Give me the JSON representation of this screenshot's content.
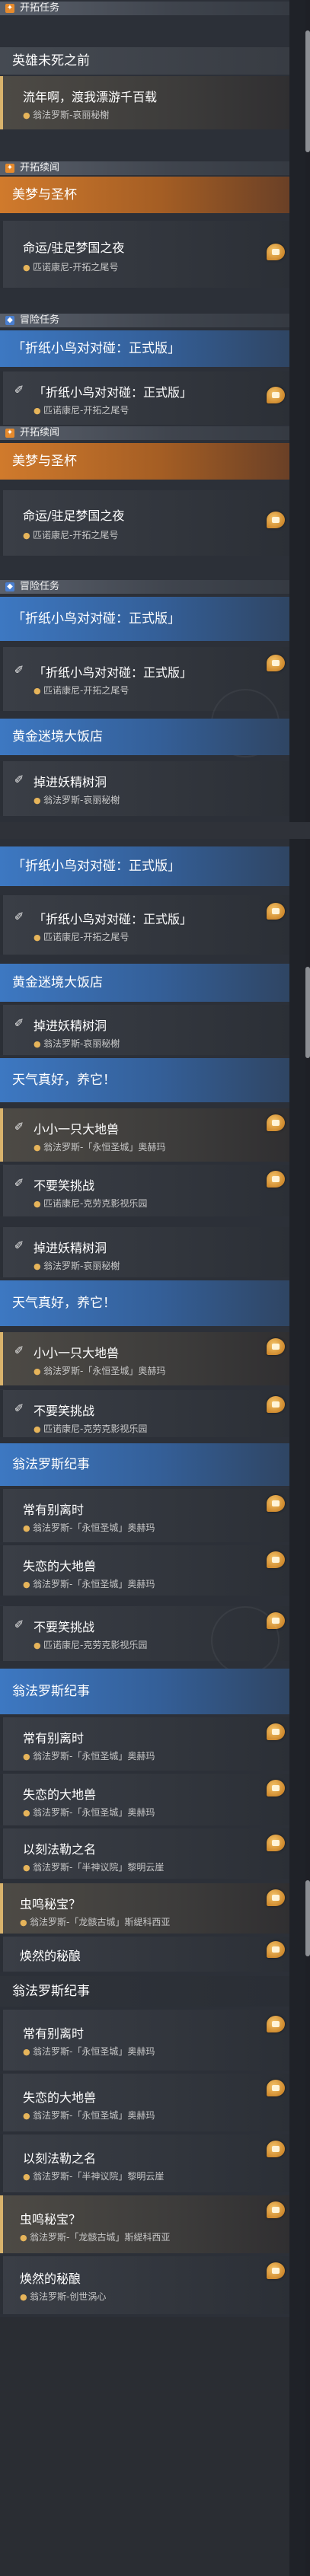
{
  "categories": {
    "trailblaze": "开拓任务",
    "continuance": "开拓续闻",
    "adventure": "冒险任务"
  },
  "headers": {
    "heroes_before_death": "英雄未死之前",
    "dream_and_grail": "美梦与圣杯",
    "origami_showdown": "「折纸小鸟对对碰：正式版」",
    "golden_maze_hotel": "黄金迷境大饭店",
    "nice_weather": "天气真好，养它！",
    "amphoreus_chronicle": "翁法罗斯纪事"
  },
  "quests": {
    "ferry_wanderer": {
      "title": "流年啊，渡我漂游千百载",
      "location": "翁法罗斯-哀丽秘榭"
    },
    "destiny_night": {
      "title": "命运/驻足梦国之夜",
      "location": "匹诺康尼-开拓之尾号"
    },
    "origami_quest": {
      "title": "「折纸小鸟对对碰：正式版」",
      "location": "匹诺康尼-开拓之尾号"
    },
    "fall_into_hole": {
      "title": "掉进妖精树洞",
      "location": "翁法罗斯-哀丽秘榭"
    },
    "little_beast": {
      "title": "小小一只大地兽",
      "location": "翁法罗斯-「永恒圣城」奥赫玛"
    },
    "no_joke_challenge": {
      "title": "不要笑挑战",
      "location": "匹诺康尼-克劳克影视乐园"
    },
    "always_parting": {
      "title": "常有别离时",
      "location": "翁法罗斯-「永恒圣城」奥赫玛"
    },
    "lost_beast": {
      "title": "失恋的大地兽",
      "location": "翁法罗斯-「永恒圣城」奥赫玛"
    },
    "carved_name": {
      "title": "以刻法勒之名",
      "location": "翁法罗斯-「半神议院」黎明云崖"
    },
    "insect_secret": {
      "title": "虫鸣秘宝？",
      "location": "翁法罗斯-「龙骸古城」斯缇科西亚"
    },
    "renewed_brew": {
      "title": "焕然的秘酿",
      "location": "翁法罗斯-创世涡心"
    }
  },
  "icons": {
    "pin": "map-pin-icon",
    "badge": "reward-badge-icon",
    "quest": "quest-bird-icon",
    "stamp": "illustration-stamp-icon"
  },
  "colors": {
    "trailblaze_orange": "#d07a2c",
    "adventure_blue": "#3d78c2",
    "selected_gold": "#d9b36c",
    "pin_gold": "#e6b45a"
  }
}
